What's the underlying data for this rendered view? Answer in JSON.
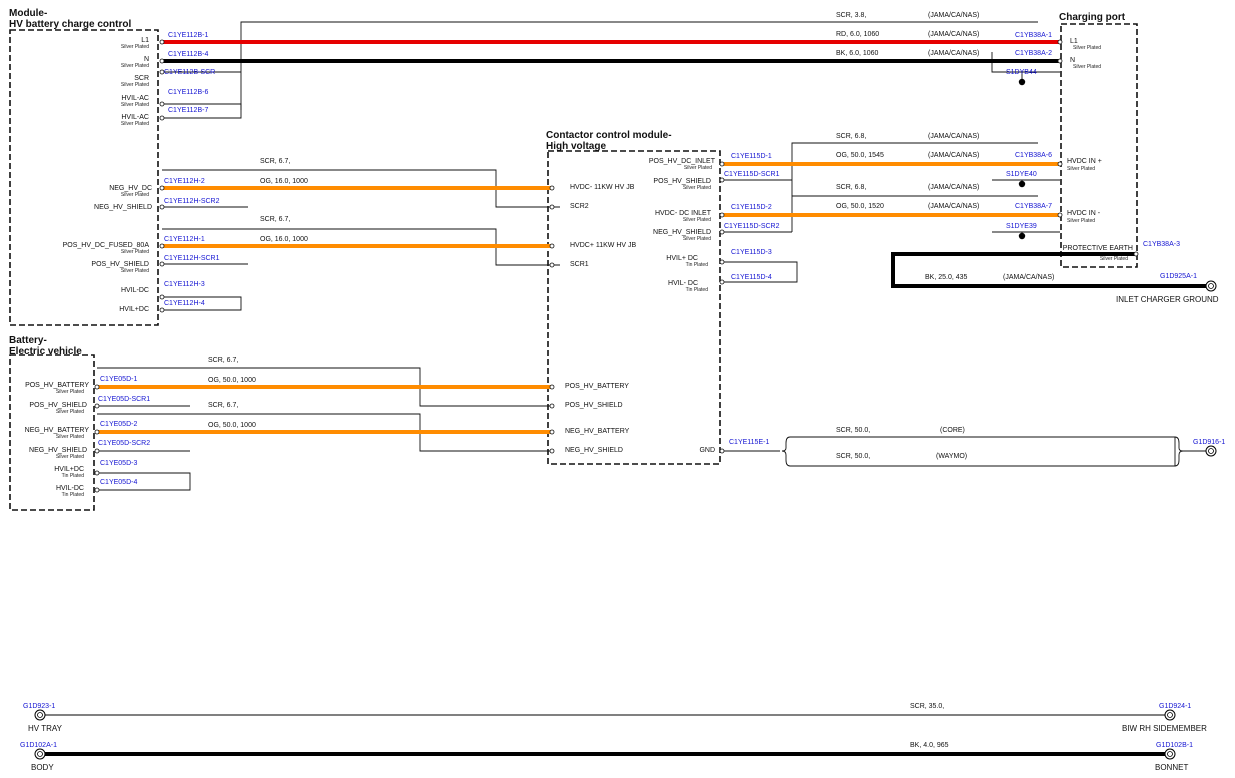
{
  "colors": {
    "red": "#e60000",
    "black": "#000000",
    "orange": "#ff8c00",
    "code_blue": "#1414d2"
  },
  "modules": {
    "hvbcc": {
      "title1": "Module-",
      "title2": "HV battery charge control"
    },
    "charging_port": {
      "title": "Charging port"
    },
    "ccm": {
      "title1": "Contactor control module-",
      "title2": "High voltage"
    },
    "battery": {
      "title1": "Battery-",
      "title2": "Electric vehicle"
    }
  },
  "hvbcc_pins": [
    {
      "name": "L1",
      "plating": "Silver Plated",
      "code": "C1YE112B-1"
    },
    {
      "name": "N",
      "plating": "Silver Plated",
      "code": "C1YE112B-4"
    },
    {
      "name": "SCR",
      "plating": "Silver Plated",
      "code": "C1YE112B-SCR"
    },
    {
      "name": "HVIL-AC",
      "plating": "Silver Plated",
      "code": "C1YE112B-6"
    },
    {
      "name": "HVIL-AC",
      "plating": "Silver Plated",
      "code": "C1YE112B-7"
    },
    {
      "name": "NEG_HV_DC",
      "plating": "Silver Plated",
      "code": "C1YE112H-2"
    },
    {
      "name": "NEG_HV_SHIELD",
      "plating": "",
      "code": "C1YE112H-SCR2"
    },
    {
      "name": "POS_HV_DC_FUSED_80A",
      "plating": "Silver Plated",
      "code": "C1YE112H-1"
    },
    {
      "name": "POS_HV_SHIELD",
      "plating": "Silver Plated",
      "code": "C1YE112H-SCR1"
    },
    {
      "name": "HVIL-DC",
      "plating": "",
      "code": "C1YE112H-3"
    },
    {
      "name": "HVIL+DC",
      "plating": "",
      "code": "C1YE112H-4"
    }
  ],
  "cp_pins": [
    {
      "name": "L1",
      "plating": "Silver Plated",
      "code": "C1YB38A-1"
    },
    {
      "name": "N",
      "plating": "Silver Plated",
      "code": "C1YB38A-2"
    },
    {
      "name": "HVDC IN +",
      "plating": "Silver Plated",
      "code": "C1YB38A-6"
    },
    {
      "name": "HVDC IN -",
      "plating": "Silver Plated",
      "code": "C1YB38A-7"
    },
    {
      "name": "PROTECTIVE EARTH",
      "plating": "Silver Plated",
      "code": "C1YB38A-3"
    }
  ],
  "splices": [
    "S1DYB44",
    "S1DYE40",
    "S1DYE39"
  ],
  "ccm_left_pins": [
    "HVDC- 11KW HV JB",
    "SCR2",
    "HVDC+ 11KW HV JB",
    "SCR1",
    "POS_HV_BATTERY",
    "POS_HV_SHIELD",
    "NEG_HV_BATTERY",
    "NEG_HV_SHIELD"
  ],
  "ccm_right_pins": [
    {
      "name": "POS_HV_DC_INLET",
      "plating": "Silver Plated",
      "code": "C1YE115D-1"
    },
    {
      "name": "POS_HV_SHIELD",
      "plating": "Silver Plated",
      "code": "C1YE115D-SCR1"
    },
    {
      "name": "HVDC- DC INLET",
      "plating": "Silver Plated",
      "code": "C1YE115D-2"
    },
    {
      "name": "NEG_HV_SHIELD",
      "plating": "Silver Plated",
      "code": "C1YE115D-SCR2"
    },
    {
      "name": "HVIL+ DC",
      "plating": "Tin Plated",
      "code": "C1YE115D-3"
    },
    {
      "name": "HVIL- DC",
      "plating": "Tin Plated",
      "code": "C1YE115D-4"
    },
    {
      "name": "GND",
      "plating": "",
      "code": "C1YE115E-1"
    }
  ],
  "battery_pins": [
    {
      "name": "POS_HV_BATTERY",
      "plating": "Silver Plated",
      "code": "C1YE05D-1"
    },
    {
      "name": "POS_HV_SHIELD",
      "plating": "Silver Plated",
      "code": "C1YE05D-SCR1"
    },
    {
      "name": "NEG_HV_BATTERY",
      "plating": "Silver Plated",
      "code": "C1YE05D-2"
    },
    {
      "name": "NEG_HV_SHIELD",
      "plating": "Silver Plated",
      "code": "C1YE05D-SCR2"
    },
    {
      "name": "HVIL+DC",
      "plating": "Tin Plated",
      "code": "C1YE05D-3"
    },
    {
      "name": "HVIL-DC",
      "plating": "Tin Plated",
      "code": "C1YE05D-4"
    }
  ],
  "wire_labels": {
    "scr_38": "SCR,  3.8,",
    "rd_6": "RD,  6.0,  1060",
    "bk_6": "BK,  6.0,  1060",
    "jama": "(JAMA/CA/NAS)",
    "scr_67": "SCR,  6.7,",
    "og_16": "OG,  16.0,  1000",
    "scr_68": "SCR,  6.8,",
    "og_50_1545": "OG,  50.0,  1545",
    "og_50_1520": "OG,  50.0,  1520",
    "bk_25": "BK,  25.0,  435",
    "og_50_1000": "OG,  50.0,  1000",
    "scr_50": "SCR,  50.0,",
    "core": "(CORE)",
    "waymo": "(WAYMO)",
    "scr_35": "SCR,  35.0,",
    "bk_4": "BK,  4.0,  965"
  },
  "grounds": {
    "inlet_charger": {
      "code": "G1D925A-1",
      "label": "INLET CHARGER GROUND"
    },
    "g1d916": {
      "code": "G1D916-1"
    },
    "hv_tray": {
      "code": "G1D923-1",
      "label": "HV TRAY"
    },
    "biw_rh": {
      "code": "G1D924-1",
      "label": "BIW RH SIDEMEMBER"
    },
    "body": {
      "code": "G1D102A-1",
      "label": "BODY"
    },
    "bonnet": {
      "code": "G1D102B-1",
      "label": "BONNET"
    }
  }
}
